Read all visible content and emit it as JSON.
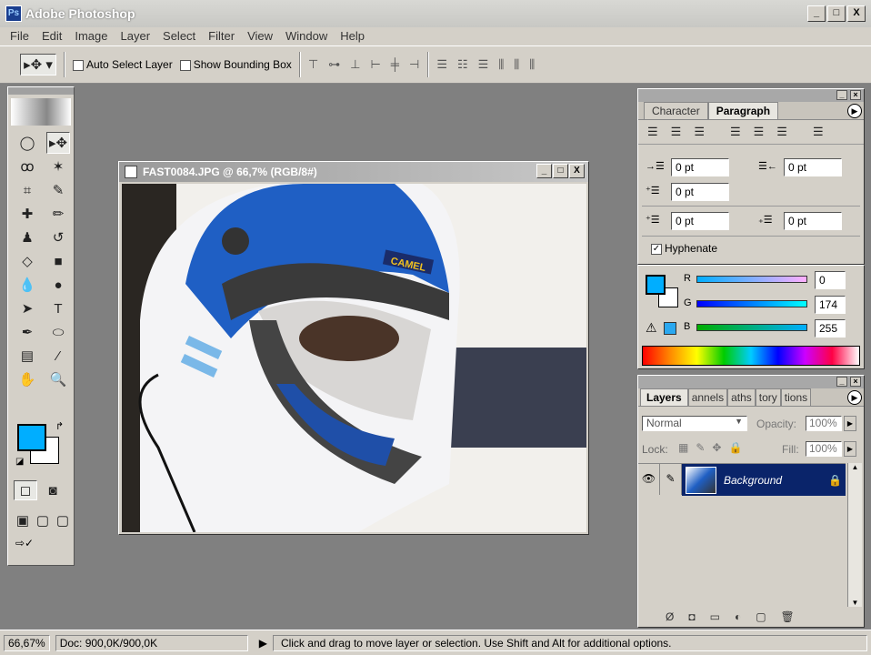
{
  "app": {
    "title": "Adobe Photoshop",
    "window_buttons": [
      "_",
      "□",
      "X"
    ]
  },
  "menu": [
    "File",
    "Edit",
    "Image",
    "Layer",
    "Select",
    "Filter",
    "View",
    "Window",
    "Help"
  ],
  "options": {
    "auto_select_layer": "Auto Select Layer",
    "show_bounding_box": "Show Bounding Box"
  },
  "document": {
    "title": "FAST0084.JPG @ 66,7% (RGB/8#)",
    "image_text": "CAMEL"
  },
  "paragraph_palette": {
    "tabs": [
      "Character",
      "Paragraph"
    ],
    "active_tab": "Paragraph",
    "indent_left": "0 pt",
    "indent_right": "0 pt",
    "indent_first": "0 pt",
    "space_before": "0 pt",
    "space_after": "0 pt",
    "hyphenate": "Hyphenate",
    "hyphenate_checked": true
  },
  "color_palette": {
    "r_label": "R",
    "g_label": "G",
    "b_label": "B",
    "r": "0",
    "g": "174",
    "b": "255",
    "foreground": "#00aeff",
    "background": "#ffffff"
  },
  "layers_palette": {
    "tabs": [
      "Layers",
      "annels",
      "aths",
      "tory",
      "tions"
    ],
    "blend_mode": "Normal",
    "opacity_label": "Opacity:",
    "opacity": "100%",
    "lock_label": "Lock:",
    "fill_label": "Fill:",
    "fill": "100%",
    "layers": [
      {
        "name": "Background",
        "visible": true,
        "locked": true,
        "selected": true
      }
    ]
  },
  "status": {
    "zoom": "66,67%",
    "doc": "Doc: 900,0K/900,0K",
    "hint": "Click and drag to move layer or selection. Use Shift and Alt for additional options."
  }
}
